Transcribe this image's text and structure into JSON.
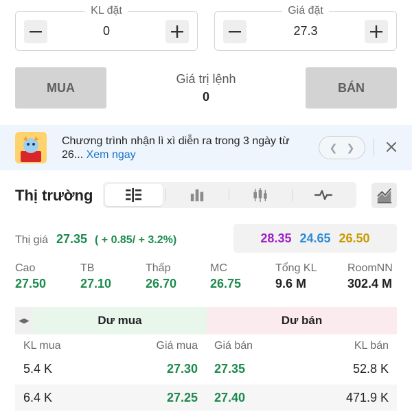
{
  "order_form": {
    "quantity": {
      "label": "KL đặt",
      "value": "0"
    },
    "price": {
      "label": "Giá đặt",
      "value": "27.3"
    },
    "buy_label": "MUA",
    "sell_label": "BÁN",
    "order_value_label": "Giá trị lệnh",
    "order_value": "0"
  },
  "banner": {
    "text": "Chương trình nhận lì xì diễn ra trong 3 ngày từ 26...",
    "link": "Xem ngay",
    "prev_icon": "chevron-left-icon",
    "next_icon": "chevron-right-icon"
  },
  "market": {
    "title": "Thị trường",
    "views": [
      "orderbook-icon",
      "bar-chart-icon",
      "candlestick-icon",
      "pulse-icon"
    ],
    "active_view": 0,
    "price_label": "Thị giá",
    "price": "27.35",
    "change": "( + 0.85/ + 3.2%)",
    "ceiling": "28.35",
    "floor": "24.65",
    "reference": "26.50",
    "stats": [
      {
        "label": "Cao",
        "value": "27.50"
      },
      {
        "label": "TB",
        "value": "27.10"
      },
      {
        "label": "Thấp",
        "value": "26.70"
      },
      {
        "label": "MC",
        "value": "26.75"
      },
      {
        "label": "Tổng KL",
        "value": "9.6 M"
      },
      {
        "label": "RoomNN",
        "value": "302.4 M"
      }
    ]
  },
  "orderbook": {
    "buy_header": "Dư mua",
    "sell_header": "Dư bán",
    "columns": [
      "KL mua",
      "Giá mua",
      "Giá bán",
      "KL bán"
    ],
    "rows": [
      {
        "buy_qty": "5.4 K",
        "buy_price": "27.30",
        "sell_price": "27.35",
        "sell_qty": "52.8 K"
      },
      {
        "buy_qty": "6.4 K",
        "buy_price": "27.25",
        "sell_price": "27.40",
        "sell_qty": "471.9 K"
      }
    ]
  },
  "colors": {
    "up": "#1e8a4e",
    "ceiling": "#a020c8",
    "floor": "#2b8ad6",
    "reference": "#c99a00",
    "neutral": "#222222"
  }
}
